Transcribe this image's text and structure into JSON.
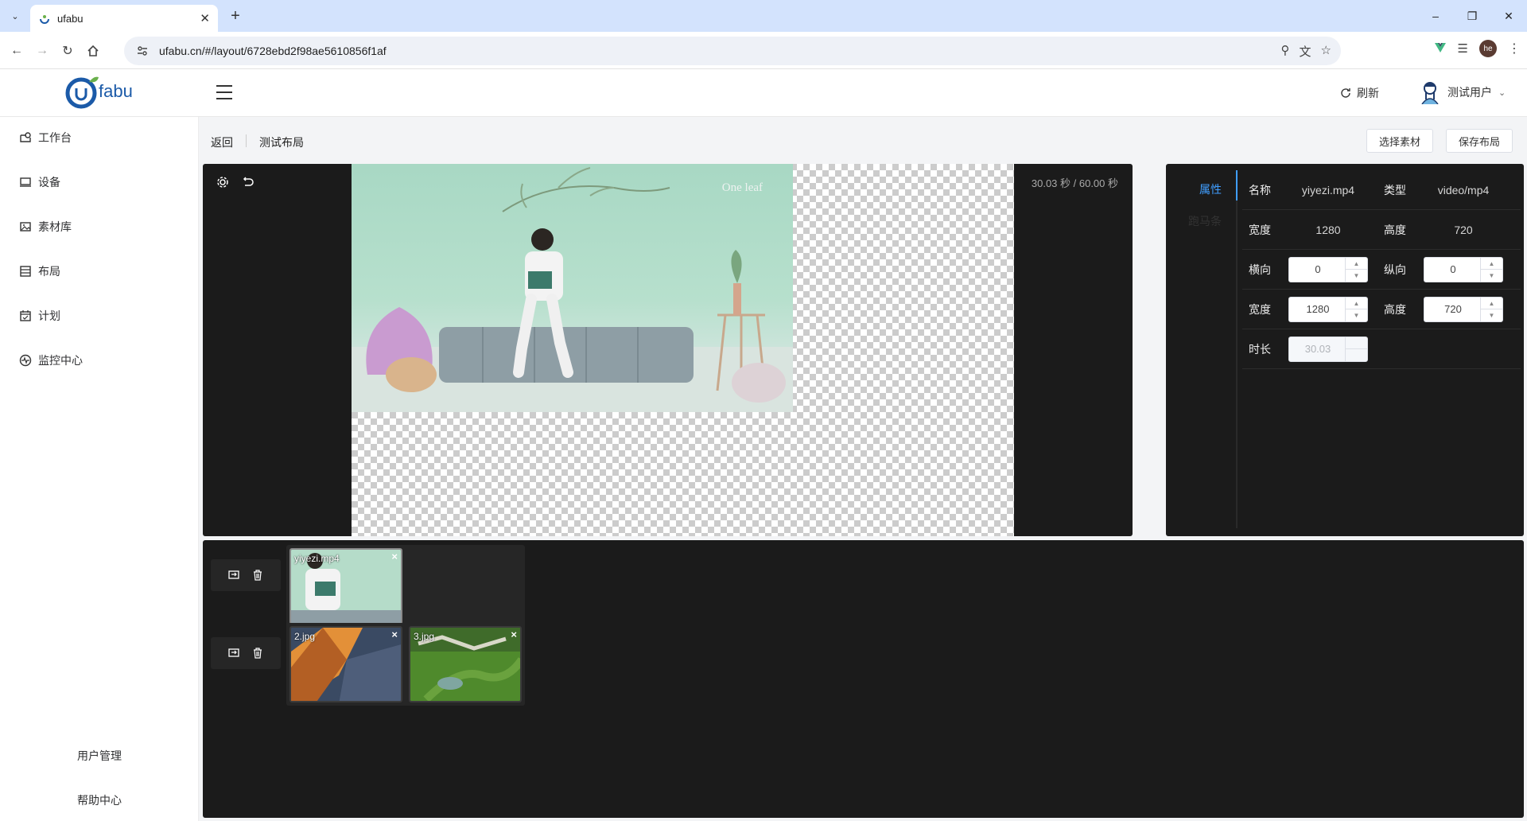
{
  "browser": {
    "tab_title": "ufabu",
    "url": "ufabu.cn/#/layout/6728ebd2f98ae5610856f1af",
    "profile_initials": "he"
  },
  "header": {
    "logo_text": "fabu",
    "refresh_label": "刷新",
    "user_name": "测试用户"
  },
  "sidebar": {
    "items": [
      {
        "label": "工作台",
        "icon": "dashboard-icon"
      },
      {
        "label": "设备",
        "icon": "monitor-icon"
      },
      {
        "label": "素材库",
        "icon": "image-library-icon"
      },
      {
        "label": "布局",
        "icon": "layout-icon"
      },
      {
        "label": "计划",
        "icon": "calendar-icon"
      },
      {
        "label": "监控中心",
        "icon": "monitor-pulse-icon"
      }
    ],
    "bottom": [
      "用户管理",
      "帮助中心"
    ]
  },
  "toolbar": {
    "back_label": "返回",
    "layout_name": "测试布局",
    "select_material_label": "选择素材",
    "save_layout_label": "保存布局"
  },
  "preview": {
    "time_text": "30.03 秒 / 60.00 秒",
    "video_caption": "One leaf"
  },
  "properties": {
    "tabs": [
      "属性",
      "跑马条"
    ],
    "name_label": "名称",
    "name_value": "yiyezi.mp4",
    "type_label": "类型",
    "type_value": "video/mp4",
    "width_label": "宽度",
    "width_value": "1280",
    "height_label": "高度",
    "height_value": "720",
    "x_label": "横向",
    "x_value": "0",
    "y_label": "纵向",
    "y_value": "0",
    "width2_label": "宽度",
    "width2_value": "1280",
    "height2_label": "高度",
    "height2_value": "720",
    "duration_label": "时长",
    "duration_value": "30.03"
  },
  "timeline": {
    "tracks": [
      {
        "clips": [
          {
            "label": "yiyezi.mp4",
            "selected": true
          }
        ]
      },
      {
        "clips": [
          {
            "label": "2.jpg",
            "selected": false
          },
          {
            "label": "3.jpg",
            "selected": false
          }
        ]
      }
    ]
  },
  "colors": {
    "accent": "#409eff",
    "panel_bg": "#1b1b1b",
    "content_bg": "#f3f4f6",
    "tabstrip_bg": "#d3e3fd"
  }
}
